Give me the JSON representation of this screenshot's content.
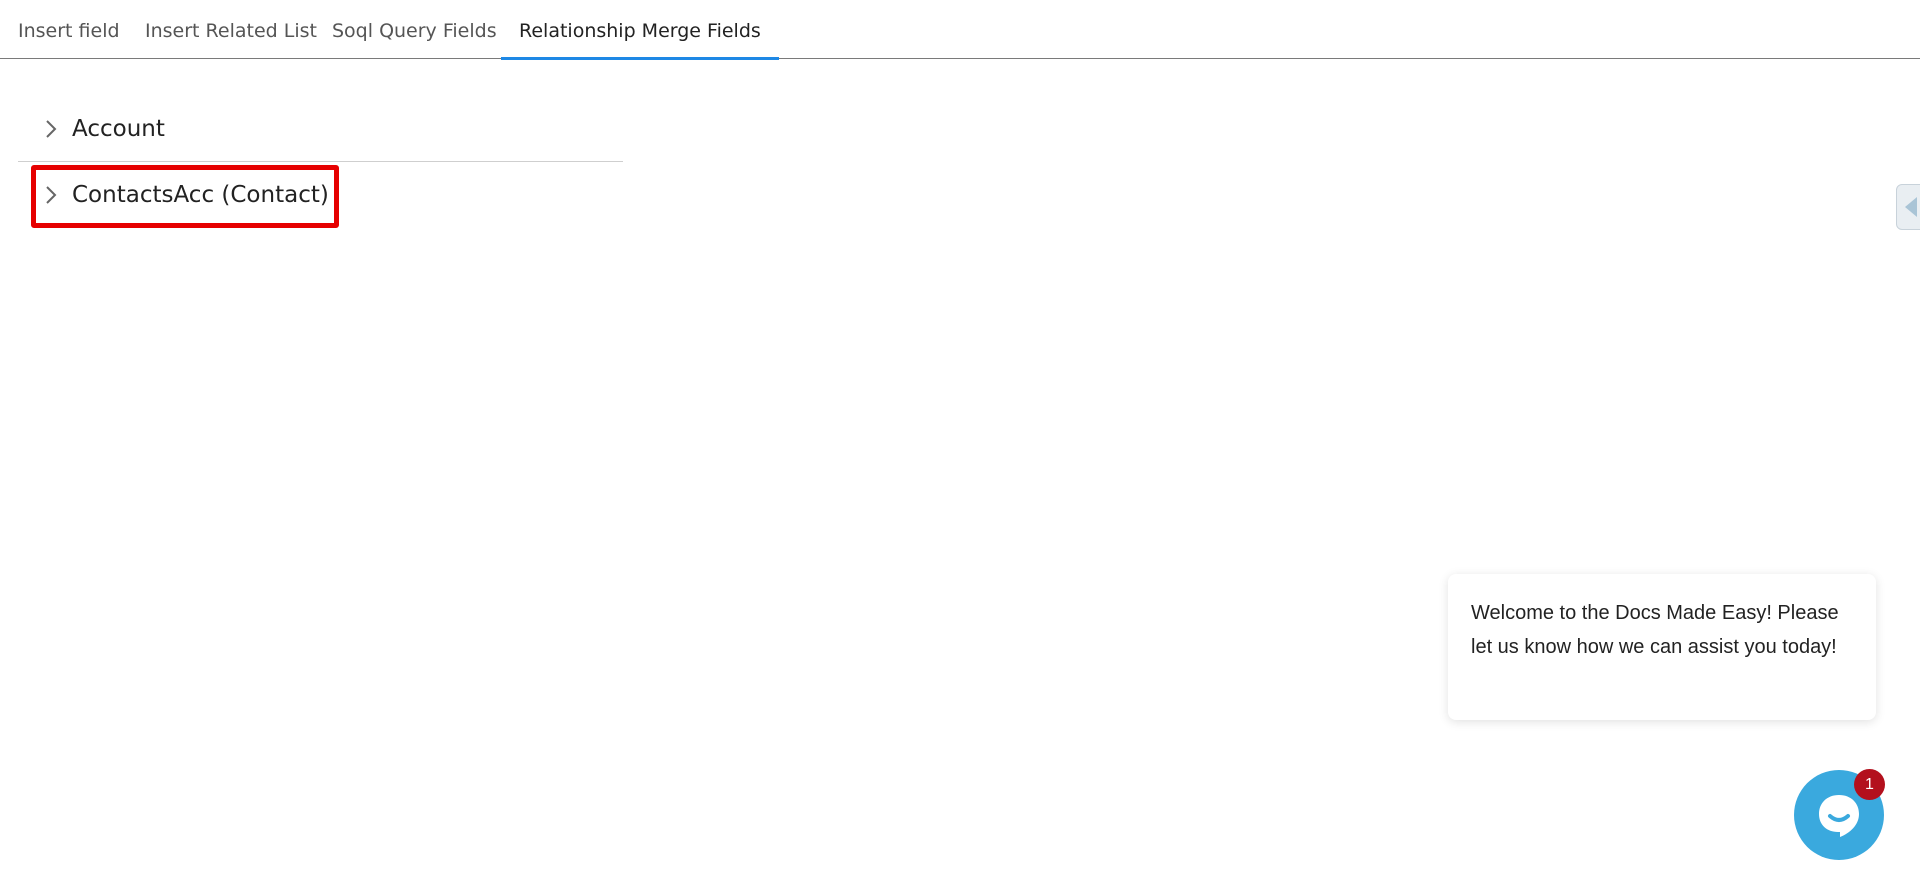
{
  "tabs": [
    {
      "label": "Insert field",
      "active": false
    },
    {
      "label": "Insert Related List",
      "active": false
    },
    {
      "label": "Soql Query Fields",
      "active": false
    },
    {
      "label": "Relationship Merge Fields",
      "active": true
    }
  ],
  "accordion": {
    "items": [
      {
        "label": "Account",
        "icon": "chevron-right-icon"
      },
      {
        "label": "ContactsAcc (Contact)",
        "icon": "chevron-right-icon",
        "highlighted": true
      }
    ]
  },
  "chat": {
    "message": "Welcome to the Docs Made Easy! Please let us know how we can assist you today!",
    "badge_count": "1",
    "launcher_icon": "chat-icon"
  },
  "colors": {
    "accent": "#1e88e5",
    "highlight": "#e60000",
    "chat_launcher": "#3aa9de",
    "badge": "#b3101d"
  }
}
